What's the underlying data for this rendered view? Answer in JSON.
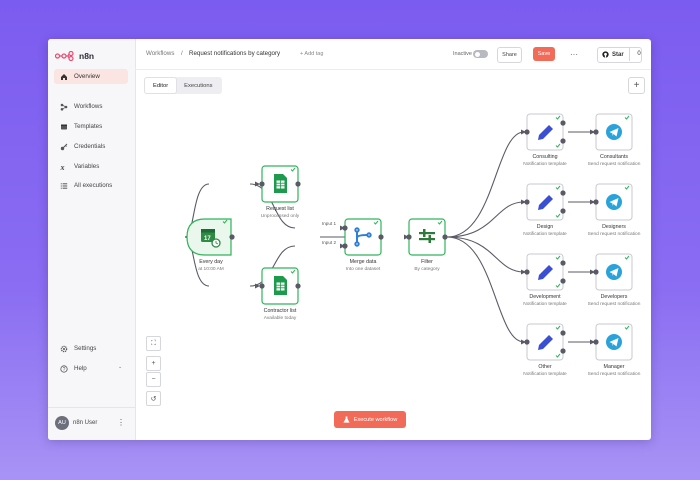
{
  "app": {
    "logo_text": "n8n"
  },
  "sidebar": {
    "items": [
      {
        "label": "Overview",
        "icon": "home-icon"
      },
      {
        "label": "Workflows",
        "icon": "workflows-icon"
      },
      {
        "label": "Templates",
        "icon": "templates-icon"
      },
      {
        "label": "Credentials",
        "icon": "key-icon"
      },
      {
        "label": "Variables",
        "icon": "variables-icon"
      },
      {
        "label": "All executions",
        "icon": "list-icon"
      }
    ],
    "bottom_items": [
      {
        "label": "Settings",
        "icon": "gear-icon"
      },
      {
        "label": "Help",
        "icon": "help-icon"
      }
    ],
    "user": {
      "initials": "AU",
      "name": "n8n User",
      "menu": "⋮"
    }
  },
  "header": {
    "breadcrumb_root": "Workflows",
    "breadcrumb_sep": "/",
    "title": "Request notifications by category",
    "add_tag": "+ Add tag",
    "inactive_label": "Inactive",
    "share_label": "Share",
    "save_label": "Save",
    "more_label": "···",
    "star_label": "Star",
    "star_count": "0"
  },
  "tabs": [
    {
      "label": "Editor",
      "active": true
    },
    {
      "label": "Executions",
      "active": false
    }
  ],
  "canvas": {
    "add_button": "+",
    "zoom_controls": [
      "⛶",
      "+",
      "−",
      "↺"
    ],
    "execute_label": "Execute workflow",
    "input_labels": [
      "Input 1",
      "Input 2"
    ],
    "nodes": [
      {
        "id": "trigger",
        "title": "Every day",
        "subtitle": "at 10:00 AM",
        "icon": "calendar-clock-icon"
      },
      {
        "id": "request_list",
        "title": "Request list",
        "subtitle": "Unprocessed only",
        "icon": "google-sheets-icon"
      },
      {
        "id": "contractor_list",
        "title": "Contractor list",
        "subtitle": "Available today",
        "icon": "google-sheets-icon"
      },
      {
        "id": "merge",
        "title": "Merge data",
        "subtitle": "Into one dataset",
        "icon": "merge-icon"
      },
      {
        "id": "filter",
        "title": "Filter",
        "subtitle": "By category",
        "icon": "filter-icon"
      },
      {
        "id": "consulting",
        "title": "Consulting",
        "subtitle": "Notification template",
        "icon": "pencil-icon"
      },
      {
        "id": "design",
        "title": "Design",
        "subtitle": "Notification template",
        "icon": "pencil-icon"
      },
      {
        "id": "development",
        "title": "Development",
        "subtitle": "Notification template",
        "icon": "pencil-icon"
      },
      {
        "id": "other",
        "title": "Other",
        "subtitle": "Notification template",
        "icon": "pencil-icon"
      },
      {
        "id": "consultants",
        "title": "Consultants",
        "subtitle": "Send request notification",
        "icon": "telegram-icon"
      },
      {
        "id": "designers",
        "title": "Designers",
        "subtitle": "Send request notification",
        "icon": "telegram-icon"
      },
      {
        "id": "developers",
        "title": "Developers",
        "subtitle": "Send request notification",
        "icon": "telegram-icon"
      },
      {
        "id": "manager",
        "title": "Manager",
        "subtitle": "Send request notification",
        "icon": "telegram-icon"
      }
    ]
  },
  "colors": {
    "accent": "#f26a58",
    "success": "#2fb35a",
    "sheets": "#1e9a4c",
    "telegram": "#2aa3db",
    "merge": "#2f7fd6",
    "filter": "#2f7a3a",
    "pencil": "#3a4fd1"
  }
}
